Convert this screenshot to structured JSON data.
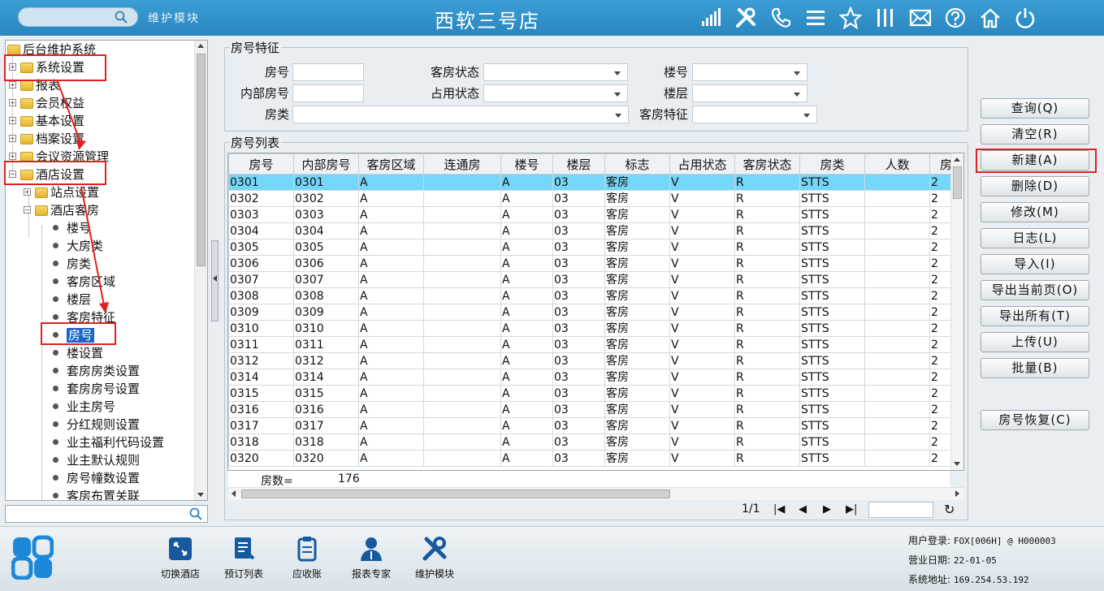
{
  "header": {
    "module": "维护模块",
    "title": "西软三号店"
  },
  "tree": {
    "root": "后台维护系统",
    "nodes": [
      "系统设置",
      "报表",
      "会员权益",
      "基本设置",
      "档案设置",
      "会议资源管理",
      "酒店设置"
    ],
    "hotel_children": [
      "站点设置",
      "酒店客房"
    ],
    "room_children": [
      "楼号",
      "大房类",
      "房类",
      "客房区域",
      "楼层",
      "客房特征",
      "房号",
      "楼设置",
      "套房房类设置",
      "套房房号设置",
      "业主房号",
      "分红规则设置",
      "业主福利代码设置",
      "业主默认规则",
      "房号幢数设置",
      "客房布置关联"
    ]
  },
  "filter": {
    "title": "房号特征",
    "room_no": "房号",
    "inner_no": "内部房号",
    "room_type": "房类",
    "room_status": "客房状态",
    "occupy_status": "占用状态",
    "building": "楼号",
    "floor": "楼层",
    "room_feature": "客房特征"
  },
  "list": {
    "title": "房号列表",
    "columns": [
      "房号",
      "内部房号",
      "客房区域",
      "连通房",
      "楼号",
      "楼层",
      "标志",
      "占用状态",
      "客房状态",
      "房类",
      "人数",
      "房"
    ],
    "rows": [
      [
        "0301",
        "0301",
        "A",
        "",
        "A",
        "03",
        "客房",
        "V",
        "R",
        "STTS",
        "",
        "2"
      ],
      [
        "0302",
        "0302",
        "A",
        "",
        "A",
        "03",
        "客房",
        "V",
        "R",
        "STTS",
        "",
        "2"
      ],
      [
        "0303",
        "0303",
        "A",
        "",
        "A",
        "03",
        "客房",
        "V",
        "R",
        "STTS",
        "",
        "2"
      ],
      [
        "0304",
        "0304",
        "A",
        "",
        "A",
        "03",
        "客房",
        "V",
        "R",
        "STTS",
        "",
        "2"
      ],
      [
        "0305",
        "0305",
        "A",
        "",
        "A",
        "03",
        "客房",
        "V",
        "R",
        "STTS",
        "",
        "2"
      ],
      [
        "0306",
        "0306",
        "A",
        "",
        "A",
        "03",
        "客房",
        "V",
        "R",
        "STTS",
        "",
        "2"
      ],
      [
        "0307",
        "0307",
        "A",
        "",
        "A",
        "03",
        "客房",
        "V",
        "R",
        "STTS",
        "",
        "2"
      ],
      [
        "0308",
        "0308",
        "A",
        "",
        "A",
        "03",
        "客房",
        "V",
        "R",
        "STTS",
        "",
        "2"
      ],
      [
        "0309",
        "0309",
        "A",
        "",
        "A",
        "03",
        "客房",
        "V",
        "R",
        "STTS",
        "",
        "2"
      ],
      [
        "0310",
        "0310",
        "A",
        "",
        "A",
        "03",
        "客房",
        "V",
        "R",
        "STTS",
        "",
        "2"
      ],
      [
        "0311",
        "0311",
        "A",
        "",
        "A",
        "03",
        "客房",
        "V",
        "R",
        "STTS",
        "",
        "2"
      ],
      [
        "0312",
        "0312",
        "A",
        "",
        "A",
        "03",
        "客房",
        "V",
        "R",
        "STTS",
        "",
        "2"
      ],
      [
        "0314",
        "0314",
        "A",
        "",
        "A",
        "03",
        "客房",
        "V",
        "R",
        "STTS",
        "",
        "2"
      ],
      [
        "0315",
        "0315",
        "A",
        "",
        "A",
        "03",
        "客房",
        "V",
        "R",
        "STTS",
        "",
        "2"
      ],
      [
        "0316",
        "0316",
        "A",
        "",
        "A",
        "03",
        "客房",
        "V",
        "R",
        "STTS",
        "",
        "2"
      ],
      [
        "0317",
        "0317",
        "A",
        "",
        "A",
        "03",
        "客房",
        "V",
        "R",
        "STTS",
        "",
        "2"
      ],
      [
        "0318",
        "0318",
        "A",
        "",
        "A",
        "03",
        "客房",
        "V",
        "R",
        "STTS",
        "",
        "2"
      ],
      [
        "0320",
        "0320",
        "A",
        "",
        "A",
        "03",
        "客房",
        "V",
        "R",
        "STTS",
        "",
        "2"
      ]
    ],
    "count_label": "房数=",
    "count_value": "176",
    "page": "1/1"
  },
  "buttons": [
    "查询(Q)",
    "清空(R)",
    "新建(A)",
    "删除(D)",
    "修改(M)",
    "日志(L)",
    "导入(I)",
    "导出当前页(O)",
    "导出所有(T)",
    "上传(U)",
    "批量(B)",
    "房号恢复(C)"
  ],
  "toolbar": [
    "切换酒店",
    "预订列表",
    "应收账",
    "报表专家",
    "维护模块"
  ],
  "status": {
    "login_label": "用户登录:",
    "login_value": "FOX[006H] @ H000003",
    "date_label": "营业日期:",
    "date_value": "22-01-05",
    "addr_label": "系统地址:",
    "addr_value": "169.254.53.192"
  },
  "colors": {
    "accent": "#2a86c0",
    "selected_row": "#74d6f8",
    "highlight": "#e02020"
  }
}
